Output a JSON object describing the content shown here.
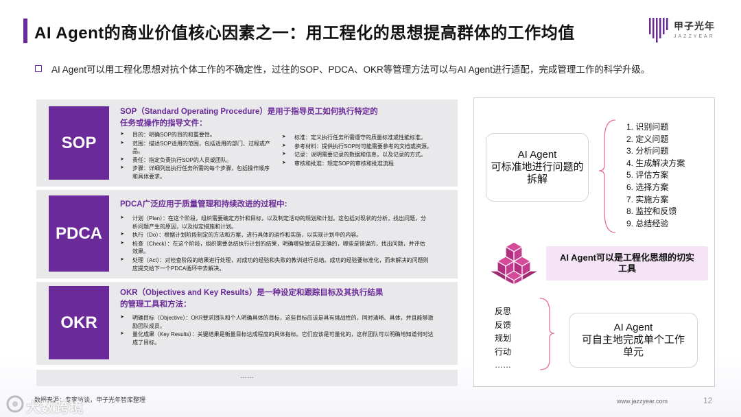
{
  "header": {
    "title": "AI Agent的商业价值核心因素之一：用工程化的思想提高群体的工作均值",
    "subtitle": "AI Agent可以用工程化思想对抗个体工作的不确定性，过往的SOP、PDCA、OKR等管理方法可以与AI Agent进行适配，完成管理工作的科学升级。"
  },
  "logo": {
    "name": "甲子光年",
    "sub": "JAZZYEAR"
  },
  "sop": {
    "tag": "SOP",
    "heading": "SOP（Standard Operating Procedure）是用于指导员工如何执行特定的任务或操作的指导文件：",
    "left_items": [
      "目的：明确SOP的目的和重要性。",
      "范围：描述SOP适用的范围，包括适用的部门、过程或产品。",
      "责任：指定负责执行SOP的人员或团队。",
      "步骤：详细列出执行任务所需的每个步骤，包括操作顺序和具体要求。"
    ],
    "right_items": [
      "标准：定义执行任务所需遵守的质量标准或性能标准。",
      "参考材料：提供执行SOP时可能需要参考的文档或资源。",
      "记录：说明需要记录的数据和信息，以及记录的方式。",
      "审核和批准：规定SOP的审核和批准流程"
    ]
  },
  "pdca": {
    "tag": "PDCA",
    "heading": "PDCA广泛应用于质量管理和持续改进的过程中:",
    "items": [
      "计划（Plan）：在这个阶段，组织需要确定方针和目标，以及制定活动的规划和计划。这包括对现状的分析，找出问题，分析问题产生的原因，以及拟定措施和计划。",
      "执行（Do）：根据计划阶段制定的方法和方案，进行具体的运作和实施，以实现计划中的内容。",
      "检查（Check）：在这个阶段，组织需要总结执行计划的结果，明确哪些做法是正确的，哪些是错误的，找出问题，并评估效果。",
      "处理（Act）：对检查阶段的结果进行处理，对成功的经验和失败的教训进行总结。成功的经验要标准化，而未解决的问题则应提交给下一个PDCA循环中去解决。"
    ]
  },
  "okr": {
    "tag": "OKR",
    "heading": "OKR（Objectives and Key Results）是一种设定和跟踪目标及其执行结果的管理工具和方法：",
    "items": [
      "明确目标（Objective）：OKR要求团队和个人明确具体的目标，这些目标应该是具有挑战性的，同时清晰、具体，并且能够激励团队成员。",
      "量化成果（Key Results）：关键结果是衡量目标达成程度的具体指标。它们应该是可量化的，这样团队可以明确地知道何时达成了目标。"
    ]
  },
  "more_text": "……",
  "right": {
    "box1": "AI Agent\n可标准地进行问题的\n拆解",
    "steps": [
      "1. 识别问题",
      "2. 定义问题",
      "3. 分析问题",
      "4. 生成解决方案",
      "5. 评估方案",
      "6. 选择方案",
      "7. 实施方案",
      "8. 监控和反馈",
      "9. 总结经验"
    ],
    "highlight": "AI Agent可以是工程化思想的切实\n工具",
    "acts": [
      "反思",
      "反馈",
      "规划",
      "行动",
      "……"
    ],
    "box2": "AI Agent\n可自主地完成单个工作\n单元"
  },
  "footer": {
    "source": "数据来源：专家访谈，甲子光年智库整理",
    "url": "www.jazzyear.com",
    "page": "12",
    "watermark": "大数跨境"
  },
  "colors": {
    "brand": "#6a2a9a",
    "card_bg": "#e9e8ea",
    "highlight_bg": "#f4e4f6"
  }
}
